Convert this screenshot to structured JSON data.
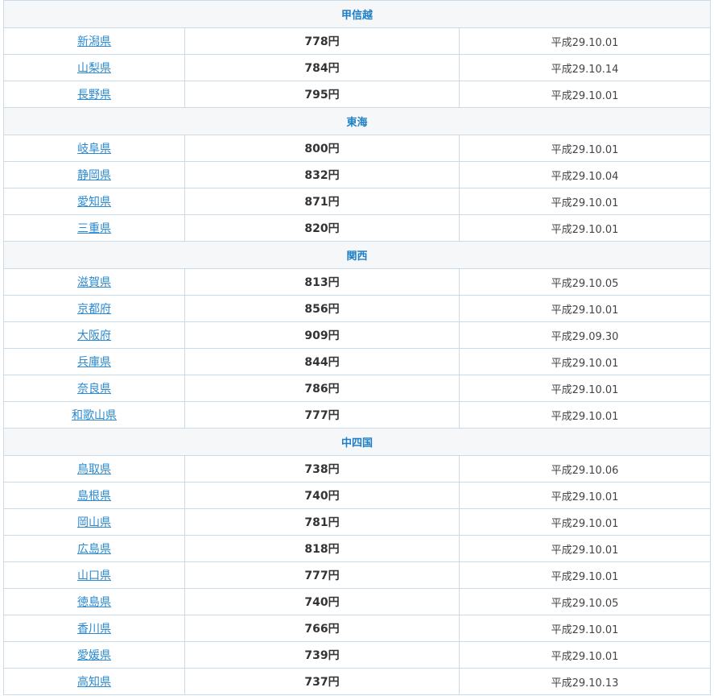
{
  "regions": [
    {
      "name": "甲信越",
      "rows": [
        {
          "pref": "新潟県",
          "wage": "778円",
          "date": "平成29.10.01"
        },
        {
          "pref": "山梨県",
          "wage": "784円",
          "date": "平成29.10.14"
        },
        {
          "pref": "長野県",
          "wage": "795円",
          "date": "平成29.10.01"
        }
      ]
    },
    {
      "name": "東海",
      "rows": [
        {
          "pref": "岐阜県",
          "wage": "800円",
          "date": "平成29.10.01"
        },
        {
          "pref": "静岡県",
          "wage": "832円",
          "date": "平成29.10.04"
        },
        {
          "pref": "愛知県",
          "wage": "871円",
          "date": "平成29.10.01"
        },
        {
          "pref": "三重県",
          "wage": "820円",
          "date": "平成29.10.01"
        }
      ]
    },
    {
      "name": "関西",
      "rows": [
        {
          "pref": "滋賀県",
          "wage": "813円",
          "date": "平成29.10.05"
        },
        {
          "pref": "京都府",
          "wage": "856円",
          "date": "平成29.10.01"
        },
        {
          "pref": "大阪府",
          "wage": "909円",
          "date": "平成29.09.30"
        },
        {
          "pref": "兵庫県",
          "wage": "844円",
          "date": "平成29.10.01"
        },
        {
          "pref": "奈良県",
          "wage": "786円",
          "date": "平成29.10.01"
        },
        {
          "pref": "和歌山県",
          "wage": "777円",
          "date": "平成29.10.01"
        }
      ]
    },
    {
      "name": "中四国",
      "rows": [
        {
          "pref": "鳥取県",
          "wage": "738円",
          "date": "平成29.10.06"
        },
        {
          "pref": "島根県",
          "wage": "740円",
          "date": "平成29.10.01"
        },
        {
          "pref": "岡山県",
          "wage": "781円",
          "date": "平成29.10.01"
        },
        {
          "pref": "広島県",
          "wage": "818円",
          "date": "平成29.10.01"
        },
        {
          "pref": "山口県",
          "wage": "777円",
          "date": "平成29.10.01"
        },
        {
          "pref": "徳島県",
          "wage": "740円",
          "date": "平成29.10.05"
        },
        {
          "pref": "香川県",
          "wage": "766円",
          "date": "平成29.10.01"
        },
        {
          "pref": "愛媛県",
          "wage": "739円",
          "date": "平成29.10.01"
        },
        {
          "pref": "高知県",
          "wage": "737円",
          "date": "平成29.10.13"
        }
      ]
    }
  ]
}
